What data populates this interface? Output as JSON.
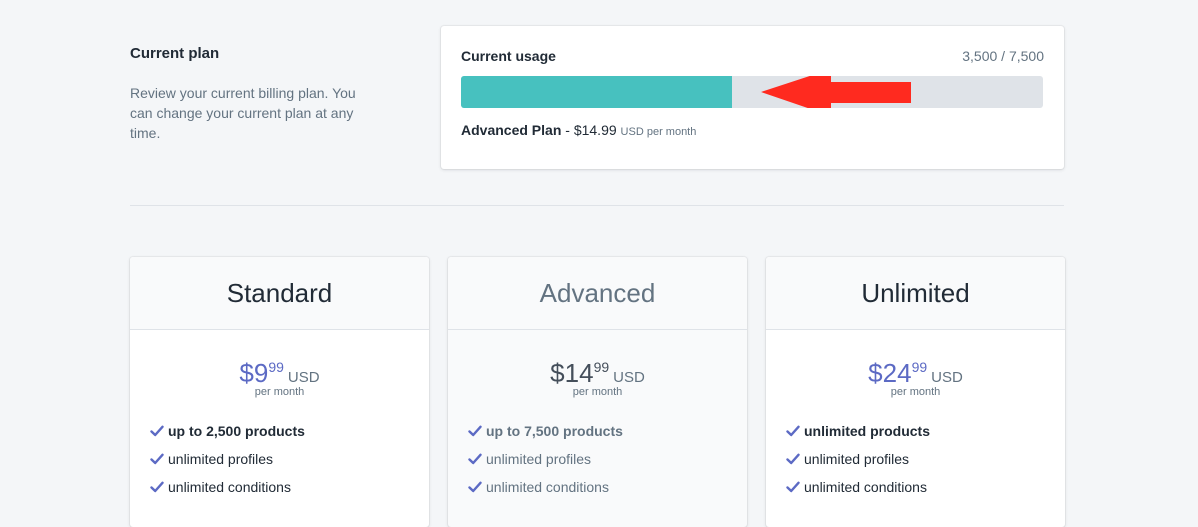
{
  "section": {
    "title": "Current plan",
    "description": "Review your current billing plan. You can change your current plan at any time."
  },
  "usage": {
    "label": "Current usage",
    "count_text": "3,500 / 7,500",
    "used": 3500,
    "limit": 7500,
    "plan_name": "Advanced Plan",
    "separator": " - ",
    "price": "$14.99",
    "unit": "USD per month",
    "bar_color": "#47c1bf",
    "annotation": "red-arrow-pointing-left"
  },
  "plans": [
    {
      "name": "Standard",
      "dollars": "$9",
      "cents": "99",
      "currency": "USD",
      "period": "per month",
      "current": false,
      "features": [
        "up to 2,500 products",
        "unlimited profiles",
        "unlimited conditions"
      ]
    },
    {
      "name": "Advanced",
      "dollars": "$14",
      "cents": "99",
      "currency": "USD",
      "period": "per month",
      "current": true,
      "features": [
        "up to 7,500 products",
        "unlimited profiles",
        "unlimited conditions"
      ]
    },
    {
      "name": "Unlimited",
      "dollars": "$24",
      "cents": "99",
      "currency": "USD",
      "period": "per month",
      "current": false,
      "features": [
        "unlimited products",
        "unlimited profiles",
        "unlimited conditions"
      ]
    }
  ],
  "colors": {
    "accent": "#5c6ac4",
    "progress": "#47c1bf",
    "arrow": "#ff2a1f",
    "check": "#5c6ac4"
  },
  "icons": {
    "feature": "check-icon",
    "annotation": "arrow-left-icon"
  }
}
